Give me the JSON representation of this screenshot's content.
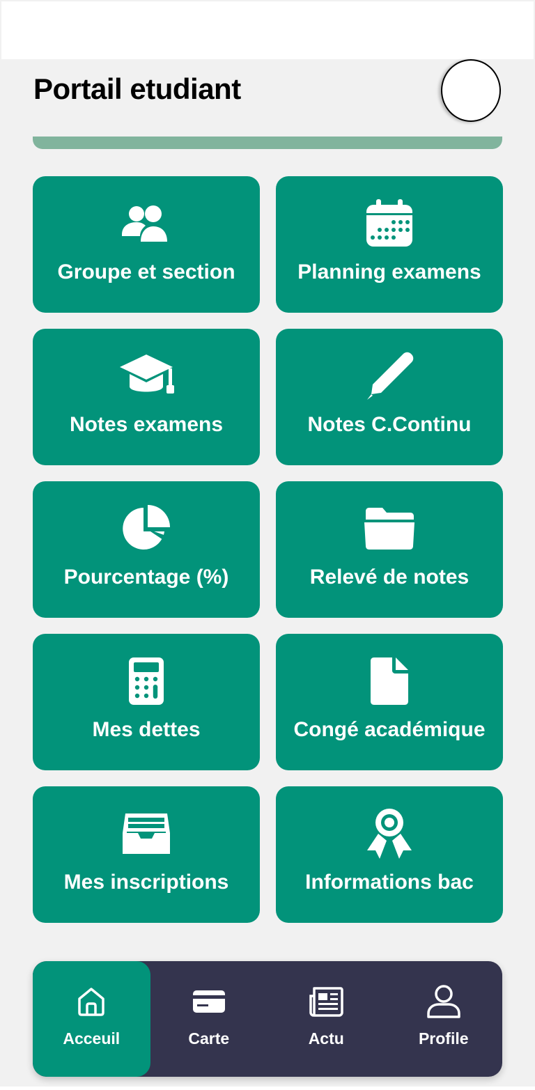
{
  "header": {
    "title": "Portail etudiant"
  },
  "colors": {
    "tile": "#02937a",
    "nav_bg": "#34344e",
    "nav_active": "#02937a",
    "progress": "#81b49d",
    "background": "#f1f1f1"
  },
  "tiles": [
    {
      "label": "Groupe et section",
      "icon": "users-icon"
    },
    {
      "label": "Planning examens",
      "icon": "calendar-icon"
    },
    {
      "label": "Notes examens",
      "icon": "graduation-cap-icon"
    },
    {
      "label": "Notes C.Continu",
      "icon": "pencil-icon"
    },
    {
      "label": "Pourcentage (%)",
      "icon": "pie-chart-icon"
    },
    {
      "label": "Relevé de notes",
      "icon": "folder-icon"
    },
    {
      "label": "Mes dettes",
      "icon": "calculator-icon"
    },
    {
      "label": "Congé académique",
      "icon": "file-icon"
    },
    {
      "label": "Mes inscriptions",
      "icon": "inbox-icon"
    },
    {
      "label": "Informations bac",
      "icon": "award-icon"
    }
  ],
  "nav": {
    "items": [
      {
        "label": "Acceuil",
        "icon": "home-icon",
        "active": true
      },
      {
        "label": "Carte",
        "icon": "credit-card-icon",
        "active": false
      },
      {
        "label": "Actu",
        "icon": "newspaper-icon",
        "active": false
      },
      {
        "label": "Profile",
        "icon": "user-icon",
        "active": false
      }
    ]
  }
}
